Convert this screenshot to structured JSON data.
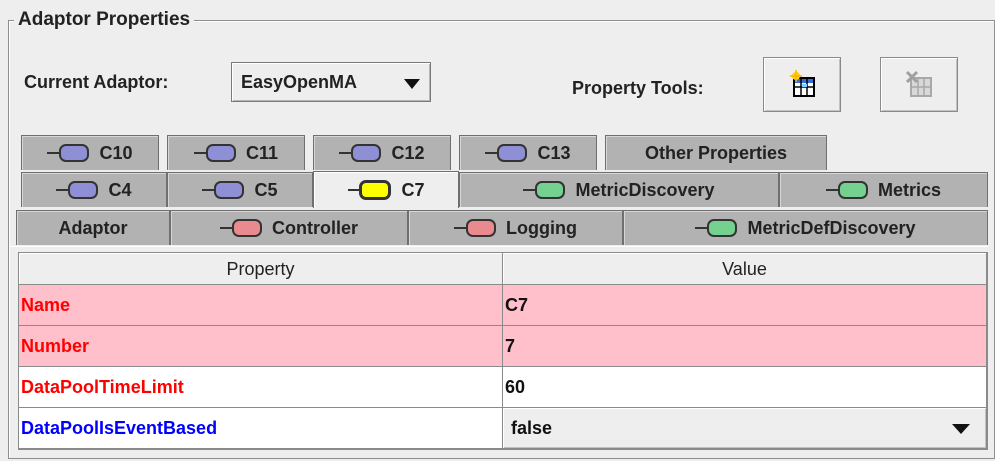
{
  "group": {
    "title": "Adaptor Properties"
  },
  "adaptor": {
    "label": "Current Adaptor:",
    "selected": "EasyOpenMA"
  },
  "tools": {
    "label": "Property Tools:",
    "add_icon": "table-add-icon",
    "remove_icon": "table-remove-icon"
  },
  "tabs": {
    "row1": [
      {
        "label": "C10",
        "indicator": "blue"
      },
      {
        "label": "C11",
        "indicator": "blue"
      },
      {
        "label": "C12",
        "indicator": "blue"
      },
      {
        "label": "C13",
        "indicator": "blue"
      },
      {
        "label": "Other Properties",
        "indicator": ""
      }
    ],
    "row2": [
      {
        "label": "C4",
        "indicator": "blue"
      },
      {
        "label": "C5",
        "indicator": "blue"
      },
      {
        "label": "C7",
        "indicator": "yellow",
        "selected": true
      },
      {
        "label": "MetricDiscovery",
        "indicator": "green"
      },
      {
        "label": "Metrics",
        "indicator": "green"
      }
    ],
    "row3": [
      {
        "label": "Adaptor",
        "indicator": ""
      },
      {
        "label": "Controller",
        "indicator": "red"
      },
      {
        "label": "Logging",
        "indicator": "red"
      },
      {
        "label": "MetricDefDiscovery",
        "indicator": "green"
      }
    ]
  },
  "table": {
    "headers": [
      "Property",
      "Value"
    ],
    "rows": [
      {
        "property": "Name",
        "value": "C7",
        "highlight": "#ffc0cb",
        "color": "#ff0000"
      },
      {
        "property": "Number",
        "value": "7",
        "highlight": "#ffc0cb",
        "color": "#ff0000"
      },
      {
        "property": "DataPoolTimeLimit",
        "value": "60",
        "highlight": "#ffffff",
        "color": "#ff0000"
      },
      {
        "property": "DataPoolIsEventBased",
        "value": "false",
        "highlight": "#ffffff",
        "color": "#0000ff"
      }
    ]
  },
  "colors": {
    "blue_dot": "#8f8fd6",
    "green_dot": "#74d18f",
    "red_dot": "#e98a8f",
    "yellow_dot": "#ffff00"
  }
}
